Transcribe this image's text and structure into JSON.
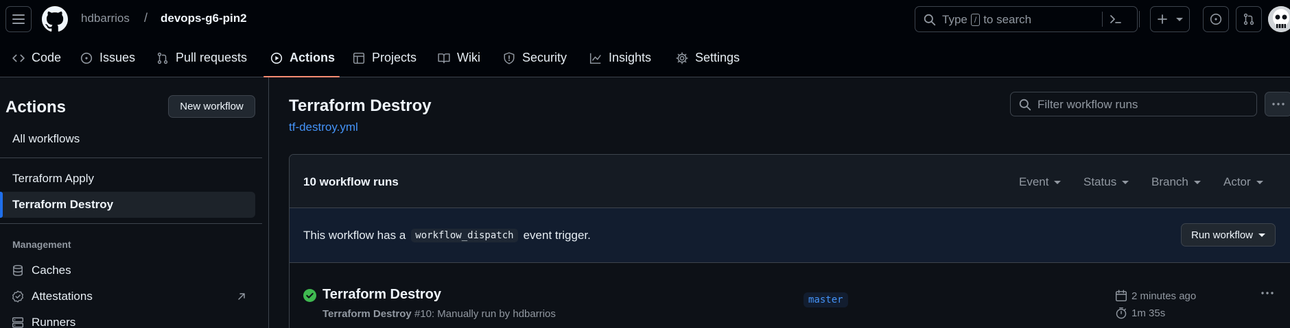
{
  "header": {
    "owner": "hdbarrios",
    "separator": "/",
    "repo": "devops-g6-pin2",
    "search_prefix": "Type",
    "search_key": "/",
    "search_suffix": "to search"
  },
  "repo_nav": {
    "tabs": [
      {
        "label": "Code",
        "icon": "code-icon"
      },
      {
        "label": "Issues",
        "icon": "issue-icon"
      },
      {
        "label": "Pull requests",
        "icon": "pull-request-icon"
      },
      {
        "label": "Actions",
        "icon": "play-icon",
        "active": true
      },
      {
        "label": "Projects",
        "icon": "table-icon"
      },
      {
        "label": "Wiki",
        "icon": "book-icon"
      },
      {
        "label": "Security",
        "icon": "shield-icon"
      },
      {
        "label": "Insights",
        "icon": "graph-icon"
      },
      {
        "label": "Settings",
        "icon": "gear-icon"
      }
    ]
  },
  "sidebar": {
    "title": "Actions",
    "new_workflow": "New workflow",
    "all_workflows": "All workflows",
    "workflows": [
      "Terraform Apply",
      "Terraform Destroy"
    ],
    "active_workflow": "Terraform Destroy",
    "section_management": "Management",
    "management_items": [
      {
        "label": "Caches",
        "icon": "database-icon"
      },
      {
        "label": "Attestations",
        "icon": "verified-icon",
        "external": true
      },
      {
        "label": "Runners",
        "icon": "server-icon"
      }
    ]
  },
  "main": {
    "title": "Terraform Destroy",
    "file": "tf-destroy.yml",
    "filter_placeholder": "Filter workflow runs",
    "runs_count": "10 workflow runs",
    "filters": [
      "Event",
      "Status",
      "Branch",
      "Actor"
    ],
    "dispatch_pre": "This workflow has a",
    "dispatch_code": "workflow_dispatch",
    "dispatch_post": "event trigger.",
    "run_workflow": "Run workflow",
    "runs": [
      {
        "title": "Terraform Destroy",
        "workflow": "Terraform Destroy",
        "detail": "#10: Manually run by hdbarrios",
        "branch": "master",
        "time_ago": "2 minutes ago",
        "duration": "1m 35s",
        "status": "success"
      }
    ]
  },
  "colors": {
    "accent_blue": "#4493f8",
    "success_green": "#3fb950",
    "tab_underline": "#fd8c73",
    "active_indicator": "#1f6feb"
  }
}
